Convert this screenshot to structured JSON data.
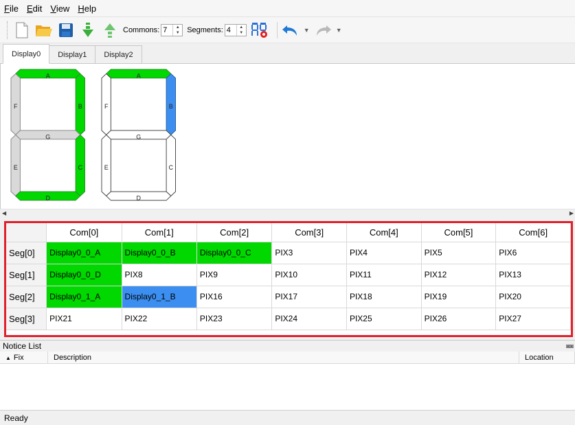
{
  "menu": [
    {
      "label": "File",
      "accel": "F",
      "rest": "ile"
    },
    {
      "label": "Edit",
      "accel": "E",
      "rest": "dit"
    },
    {
      "label": "View",
      "accel": "V",
      "rest": "iew"
    },
    {
      "label": "Help",
      "accel": "H",
      "rest": "elp"
    }
  ],
  "toolbar": {
    "commons_label": "Commons:",
    "commons_value": "7",
    "segments_label": "Segments:",
    "segments_value": "4"
  },
  "tabs": [
    "Display0",
    "Display1",
    "Display2"
  ],
  "active_tab": "Display0",
  "digits": [
    {
      "segments": {
        "A": "A",
        "B": "B",
        "C": "C",
        "D": "D",
        "E": "E",
        "F": "F",
        "G": "G"
      },
      "states": {
        "A": "green",
        "B": "green",
        "C": "green",
        "D": "green",
        "E": "gray",
        "F": "gray",
        "G": "gray"
      }
    },
    {
      "segments": {
        "A": "A",
        "B": "B",
        "C": "C",
        "D": "D",
        "E": "E",
        "F": "F",
        "G": "G"
      },
      "states": {
        "A": "green",
        "B": "blue",
        "C": "white",
        "D": "white",
        "E": "white",
        "F": "white",
        "G": "white"
      }
    }
  ],
  "colors": {
    "green": "#00d800",
    "blue": "#3c8ff0",
    "gray": "#d9d9d9",
    "white": "#ffffff",
    "highlight_border": "#e0202a"
  },
  "grid": {
    "columns": [
      "Com[0]",
      "Com[1]",
      "Com[2]",
      "Com[3]",
      "Com[4]",
      "Com[5]",
      "Com[6]"
    ],
    "rows": [
      {
        "header": "Seg[0]",
        "cells": [
          "Display0_0_A",
          "Display0_0_B",
          "Display0_0_C",
          "PIX3",
          "PIX4",
          "PIX5",
          "PIX6"
        ],
        "states": [
          "green",
          "green",
          "green",
          "",
          "",
          "",
          ""
        ]
      },
      {
        "header": "Seg[1]",
        "cells": [
          "Display0_0_D",
          "PIX8",
          "PIX9",
          "PIX10",
          "PIX11",
          "PIX12",
          "PIX13"
        ],
        "states": [
          "green",
          "",
          "",
          "",
          "",
          "",
          ""
        ]
      },
      {
        "header": "Seg[2]",
        "cells": [
          "Display0_1_A",
          "Display0_1_B",
          "PIX16",
          "PIX17",
          "PIX18",
          "PIX19",
          "PIX20"
        ],
        "states": [
          "green",
          "blue",
          "",
          "",
          "",
          "",
          ""
        ]
      },
      {
        "header": "Seg[3]",
        "cells": [
          "PIX21",
          "PIX22",
          "PIX23",
          "PIX24",
          "PIX25",
          "PIX26",
          "PIX27"
        ],
        "states": [
          "",
          "",
          "",
          "",
          "",
          "",
          ""
        ]
      }
    ]
  },
  "notice": {
    "title": "Notice List",
    "col_fix": "Fix",
    "col_description": "Description",
    "col_location": "Location"
  },
  "status": "Ready"
}
